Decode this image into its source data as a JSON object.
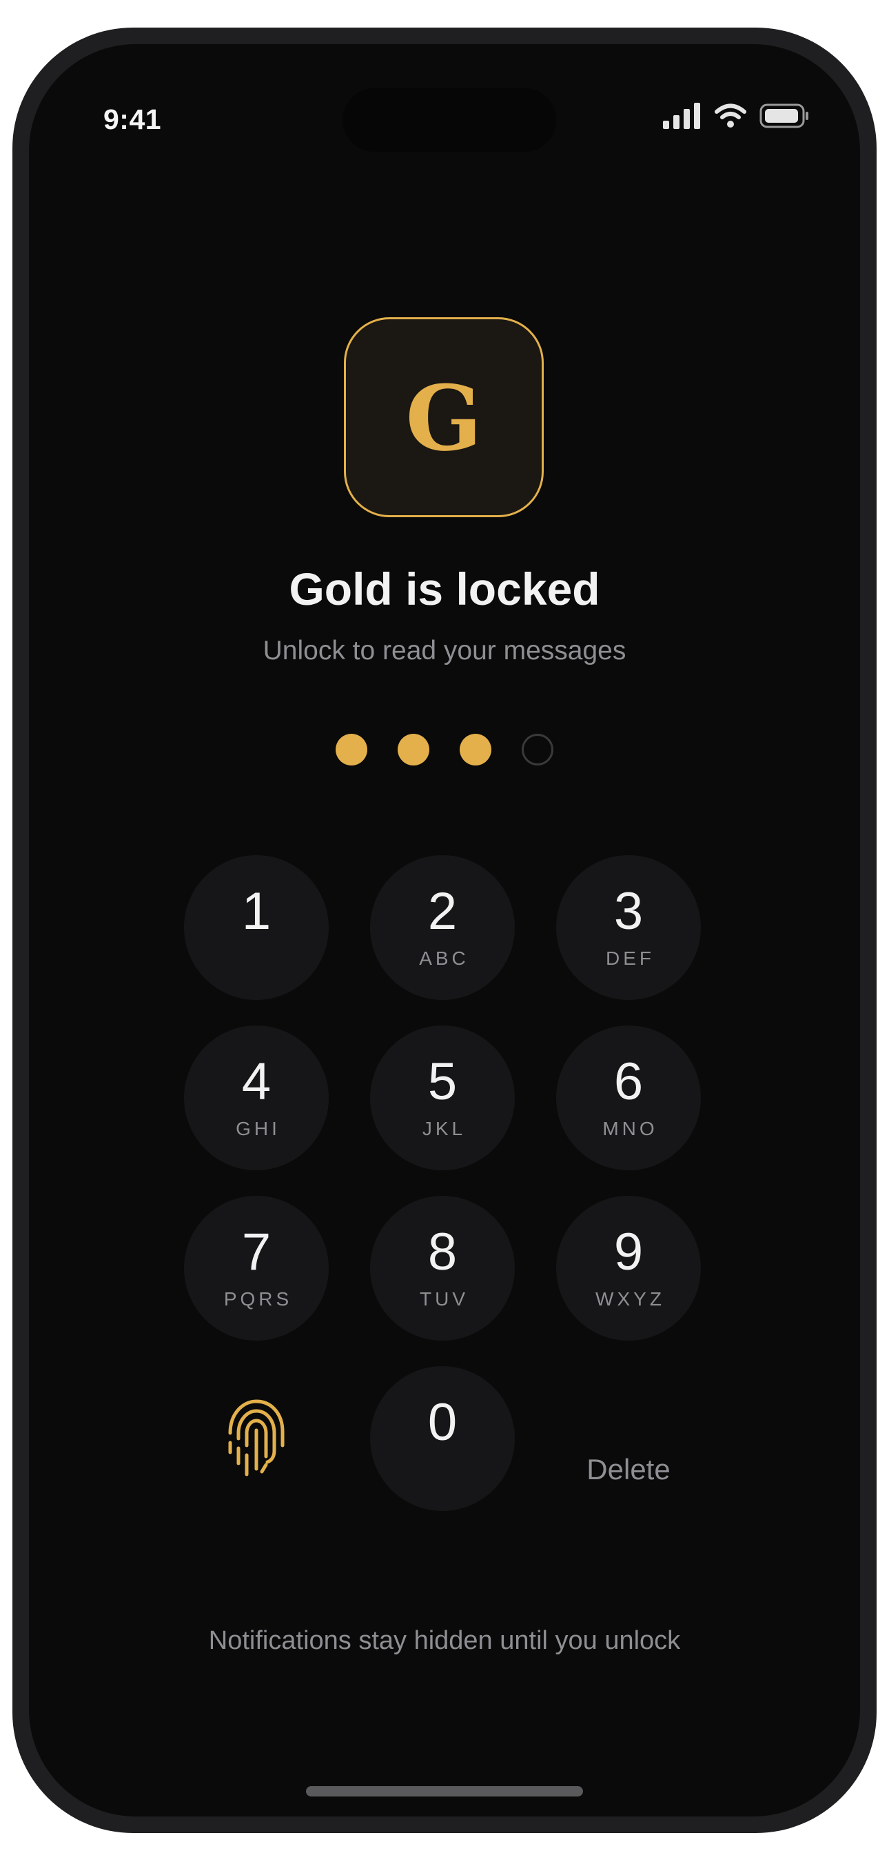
{
  "status_bar": {
    "time": "9:41",
    "icons": [
      "signal-icon",
      "wifi-icon",
      "battery-icon"
    ]
  },
  "app": {
    "icon_letter": "G",
    "accent_color": "#e3b04b"
  },
  "lock": {
    "title": "Gold is locked",
    "subtitle": "Unlock to read your messages",
    "passcode_length": 4,
    "digits_entered": 3
  },
  "keypad": {
    "keys": [
      {
        "digit": "1",
        "letters": ""
      },
      {
        "digit": "2",
        "letters": "ABC"
      },
      {
        "digit": "3",
        "letters": "DEF"
      },
      {
        "digit": "4",
        "letters": "GHI"
      },
      {
        "digit": "5",
        "letters": "JKL"
      },
      {
        "digit": "6",
        "letters": "MNO"
      },
      {
        "digit": "7",
        "letters": "PQRS"
      },
      {
        "digit": "8",
        "letters": "TUV"
      },
      {
        "digit": "9",
        "letters": "WXYZ"
      },
      {
        "digit": "0",
        "letters": ""
      }
    ],
    "biometric_icon": "fingerprint-icon",
    "delete_label": "Delete"
  },
  "footer": {
    "note": "Notifications stay hidden until you unlock"
  }
}
